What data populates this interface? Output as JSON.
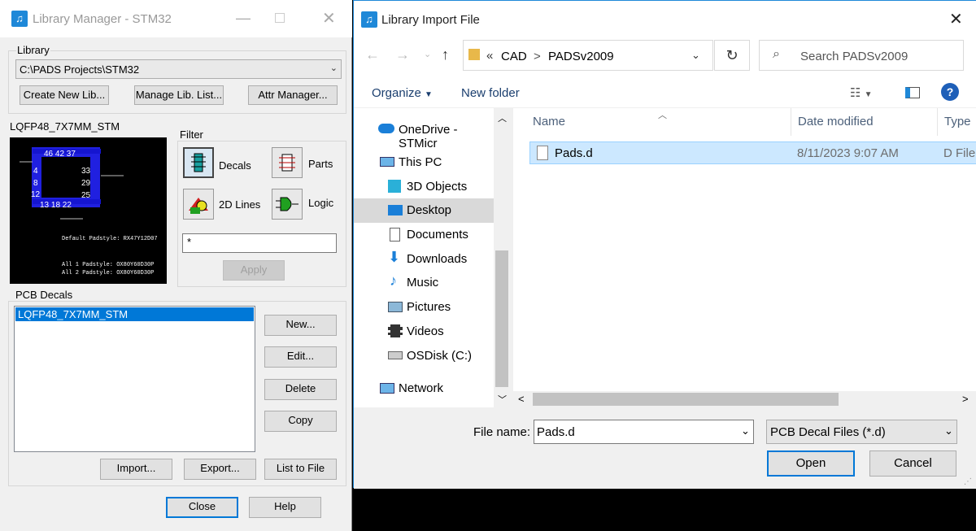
{
  "library_manager": {
    "title": "Library Manager - STM32",
    "library_group_label": "Library",
    "library_path": "C:\\PADS Projects\\STM32",
    "buttons": {
      "create_new_lib": "Create New Lib...",
      "manage_lib_list": "Manage Lib. List...",
      "attr_manager": "Attr Manager...",
      "apply": "Apply",
      "new": "New...",
      "edit": "Edit...",
      "delete": "Delete",
      "copy": "Copy",
      "import": "Import...",
      "export": "Export...",
      "list_to_file": "List to File",
      "close": "Close",
      "help": "Help"
    },
    "preview_name": "LQFP48_7X7MM_STM",
    "preview_text": {
      "top_pins": "46 42 37",
      "right_pins_1": "33",
      "right_pins_2": "29",
      "right_pins_3": "25",
      "left_pin_1": "4",
      "left_pin_2": "8",
      "left_pin_3": "12",
      "bottom_pins": "13 18 22",
      "default_padstyle": "Default Padstyle: RX47Y12D07",
      "all1_padstyle": "All 1 Padstyle: OX80Y60D30P",
      "all2_padstyle": "All 2 Padstyle: OX80Y60D30P"
    },
    "filter": {
      "label": "Filter",
      "decals": "Decals",
      "parts": "Parts",
      "lines2d": "2D Lines",
      "logic": "Logic",
      "filter_value": "*"
    },
    "pcb_decals": {
      "label": "PCB Decals",
      "items": [
        "LQFP48_7X7MM_STM"
      ]
    }
  },
  "import_dialog": {
    "title": "Library Import File",
    "breadcrumb": {
      "chevrons": "«",
      "cad": "CAD",
      "sep": ">",
      "folder": "PADSv2009"
    },
    "search_placeholder": "Search PADSv2009",
    "toolbar": {
      "organize": "Organize",
      "new_folder": "New folder"
    },
    "nav": {
      "onedrive": "OneDrive - STMicr",
      "this_pc": "This PC",
      "objects3d": "3D Objects",
      "desktop": "Desktop",
      "documents": "Documents",
      "downloads": "Downloads",
      "music": "Music",
      "pictures": "Pictures",
      "videos": "Videos",
      "osdisk": "OSDisk (C:)",
      "network": "Network"
    },
    "columns": {
      "name": "Name",
      "date_modified": "Date modified",
      "type": "Type"
    },
    "files": [
      {
        "name": "Pads.d",
        "date": "8/11/2023 9:07 AM",
        "type": "D File"
      }
    ],
    "file_name_label": "File name:",
    "file_name_value": "Pads.d",
    "file_type": "PCB Decal Files (*.d)",
    "open": "Open",
    "cancel": "Cancel"
  },
  "colors": {
    "accent": "#0078d7",
    "selection": "#cce8ff",
    "pcb_blue": "#1515d0"
  }
}
